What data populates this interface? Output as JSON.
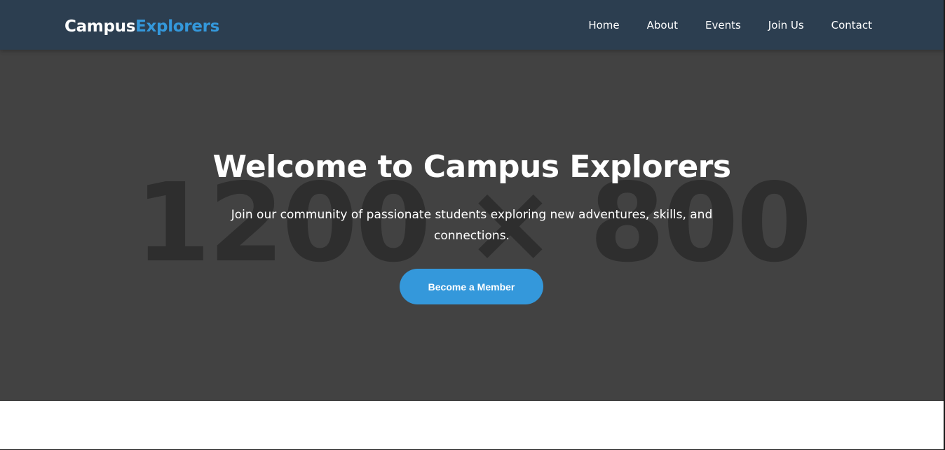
{
  "header": {
    "logo_part1": "Campus",
    "logo_part2": "Explorers",
    "nav": [
      {
        "label": "Home"
      },
      {
        "label": "About"
      },
      {
        "label": "Events"
      },
      {
        "label": "Join Us"
      },
      {
        "label": "Contact"
      }
    ]
  },
  "hero": {
    "placeholder_label": "1200 × 800",
    "title": "Welcome to Campus Explorers",
    "subtitle": "Join our community of passionate students exploring new adventures, skills, and connections.",
    "cta_label": "Become a Member"
  },
  "colors": {
    "navbar_bg": "#2c3e50",
    "accent": "#3498db",
    "hero_bg": "#424242",
    "text_light": "#ffffff"
  }
}
